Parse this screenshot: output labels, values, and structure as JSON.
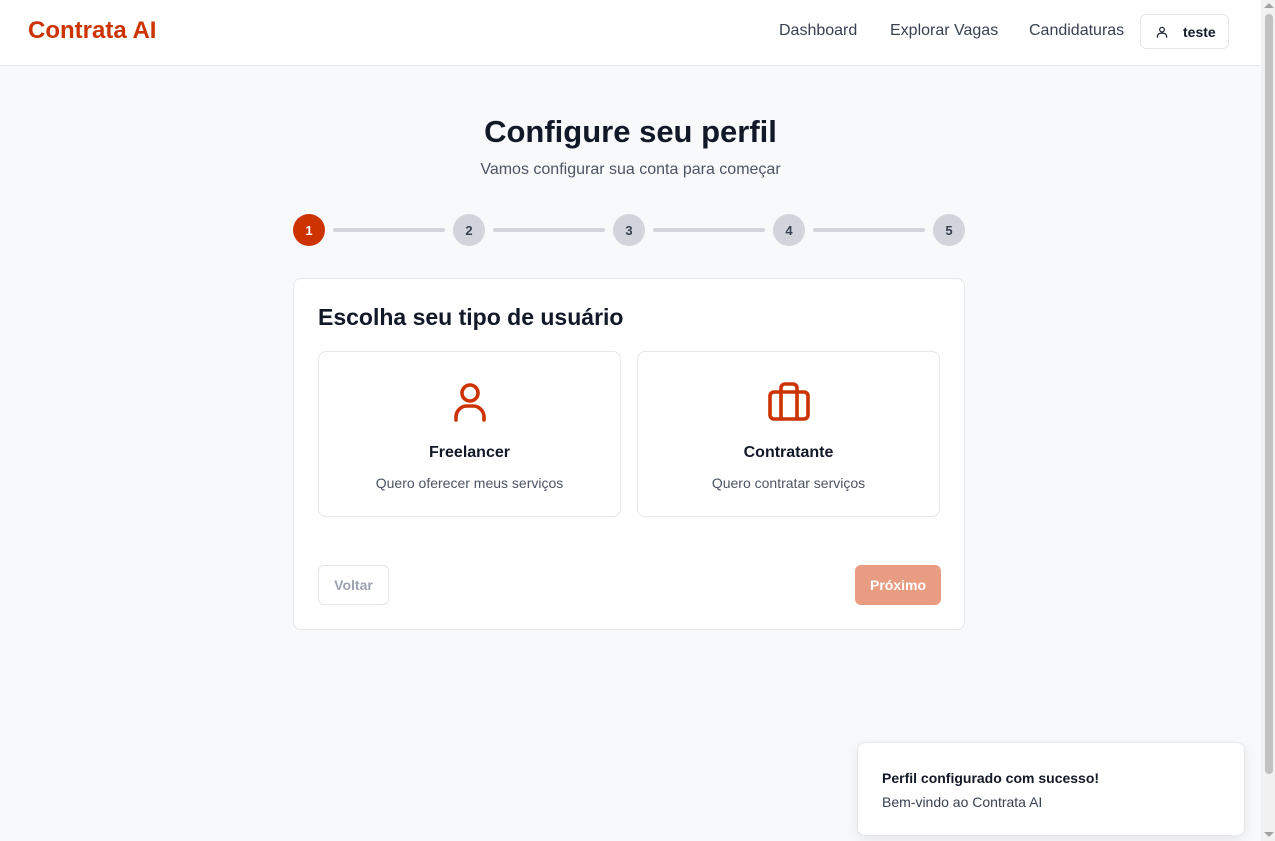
{
  "nav": {
    "brand": "Contrata AI",
    "links": [
      "Dashboard",
      "Explorar Vagas",
      "Candidaturas"
    ],
    "user_label": "teste"
  },
  "header": {
    "title": "Configure seu perfil",
    "subtitle": "Vamos configurar sua conta para começar"
  },
  "stepper": {
    "steps": [
      "1",
      "2",
      "3",
      "4",
      "5"
    ],
    "current": 1
  },
  "card": {
    "title": "Escolha seu tipo de usuário",
    "options": [
      {
        "icon": "user-icon",
        "title": "Freelancer",
        "description": "Quero oferecer meus serviços"
      },
      {
        "icon": "briefcase-icon",
        "title": "Contratante",
        "description": "Quero contratar serviços"
      }
    ],
    "back_label": "Voltar",
    "next_label": "Próximo"
  },
  "toast": {
    "title": "Perfil configurado com sucesso!",
    "description": "Bem-vindo ao Contrata AI"
  },
  "colors": {
    "brand": "#cc3300",
    "next_disabled": "#e89c82",
    "step_inactive": "#d1d5db"
  }
}
